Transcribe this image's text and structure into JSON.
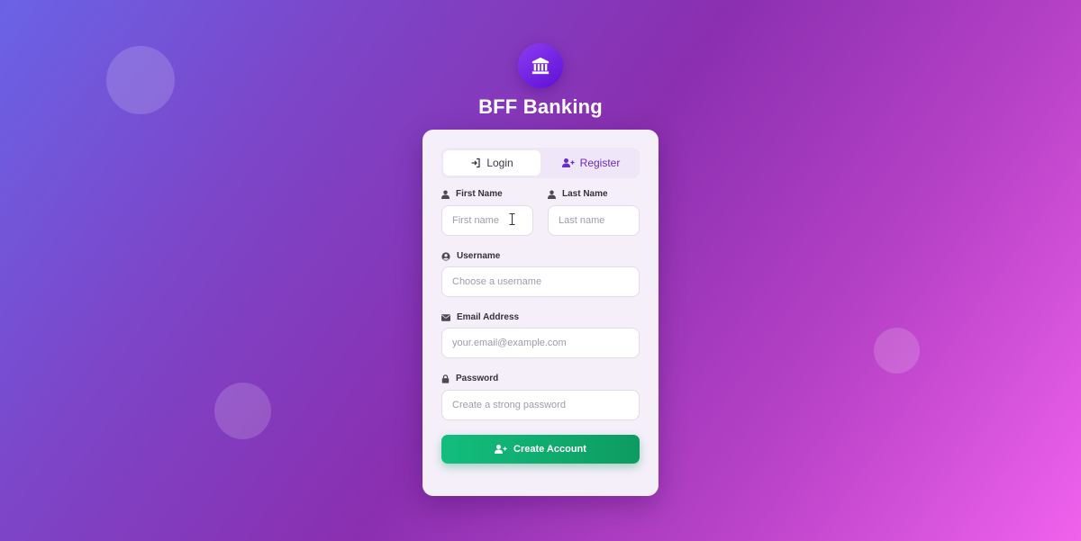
{
  "app": {
    "title": "BFF Banking",
    "accent": "#6a2bc6",
    "logo_icon": "bank-icon"
  },
  "tabs": [
    {
      "label": "Login",
      "icon": "login-icon",
      "active": false
    },
    {
      "label": "Register",
      "icon": "user-plus-icon",
      "active": true
    }
  ],
  "form": {
    "first_name": {
      "label": "First Name",
      "placeholder": "First name",
      "value": ""
    },
    "last_name": {
      "label": "Last Name",
      "placeholder": "Last name",
      "value": ""
    },
    "username": {
      "label": "Username",
      "placeholder": "Choose a username",
      "value": ""
    },
    "email": {
      "label": "Email Address",
      "placeholder": "your.email@example.com",
      "value": ""
    },
    "password": {
      "label": "Password",
      "placeholder": "Create a strong password",
      "value": ""
    },
    "submit_label": "Create Account",
    "submit_color": "#10b074"
  }
}
